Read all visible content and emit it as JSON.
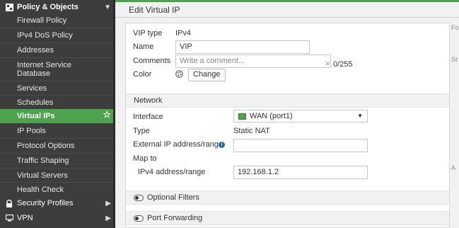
{
  "sidebar": {
    "section_title": "Policy & Objects",
    "items": [
      {
        "label": "Firewall Policy"
      },
      {
        "label": "IPv4 DoS Policy"
      },
      {
        "label": "Addresses"
      },
      {
        "label": "Internet Service Database"
      },
      {
        "label": "Services"
      },
      {
        "label": "Schedules"
      },
      {
        "label": "Virtual IPs",
        "active": true
      },
      {
        "label": "IP Pools"
      },
      {
        "label": "Protocol Options"
      },
      {
        "label": "Traffic Shaping"
      },
      {
        "label": "Virtual Servers"
      },
      {
        "label": "Health Check"
      }
    ],
    "bottom_sections": [
      {
        "label": "Security Profiles"
      },
      {
        "label": "VPN"
      }
    ]
  },
  "main": {
    "title": "Edit Virtual IP",
    "right_fragments": [
      "Fo",
      "St",
      "A"
    ],
    "form": {
      "vip_type_label": "VIP type",
      "vip_type_value": "IPv4",
      "name_label": "Name",
      "name_value": "VIP",
      "comments_label": "Comments",
      "comments_placeholder": "Write a comment...",
      "comments_counter": "0/255",
      "color_label": "Color",
      "color_button": "Change"
    },
    "network": {
      "header": "Network",
      "interface_label": "Interface",
      "interface_value": "WAN (port1)",
      "type_label": "Type",
      "type_value": "Static NAT",
      "ext_ip_label": "External IP address/range",
      "ext_ip_value": "",
      "map_to_label": "Map to",
      "ipv4_range_label": "IPv4 address/range",
      "ipv4_range_value": "192.168.1.2"
    },
    "optional_filters_label": "Optional Filters",
    "port_forwarding_label": "Port Forwarding"
  }
}
